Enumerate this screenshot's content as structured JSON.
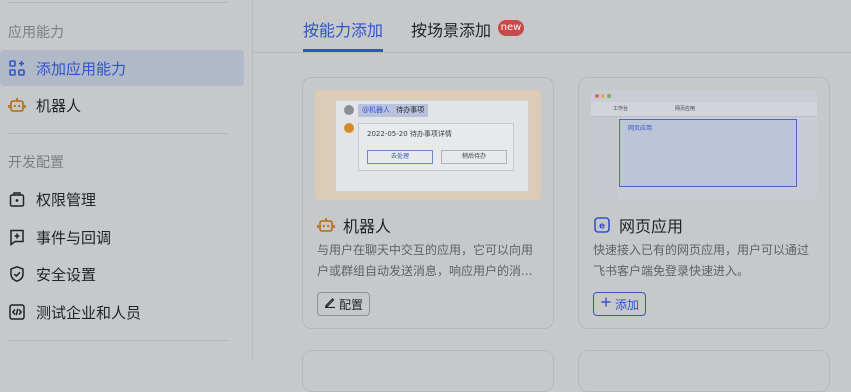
{
  "sidebar": {
    "section_app": "应用能力",
    "item_add_capability": "添加应用能力",
    "item_bot": "机器人",
    "section_dev": "开发配置",
    "item_permissions": "权限管理",
    "item_events": "事件与回调",
    "item_security": "安全设置",
    "item_test": "测试企业和人员"
  },
  "tabs": {
    "by_capability": "按能力添加",
    "by_scenario": "按场景添加",
    "new_badge": "new"
  },
  "cards": {
    "bot": {
      "title": "机器人",
      "desc": "与用户在聊天中交互的应用，它可以向用户或群组自动发送消息，响应用户的消...",
      "button": "配置",
      "preview": {
        "tag": "@机器人",
        "text": "待办事项",
        "date_line": "2022-05-20 待办事项详情",
        "btn_left": "去处理",
        "btn_right": "稍后待办"
      }
    },
    "web": {
      "title": "网页应用",
      "desc": "快速接入已有的网页应用，用户可以通过飞书客户端免登录快速进入。",
      "button": "添加",
      "preview": {
        "tab1": "工作台",
        "tab2": "网页应用",
        "panel_label": "网页应用"
      }
    }
  },
  "colors": {
    "accent": "#2f55c5",
    "badge": "#c94848",
    "bot_preview_bg": "#dccbb5",
    "web_preview_bg": "#b9c0d4"
  }
}
